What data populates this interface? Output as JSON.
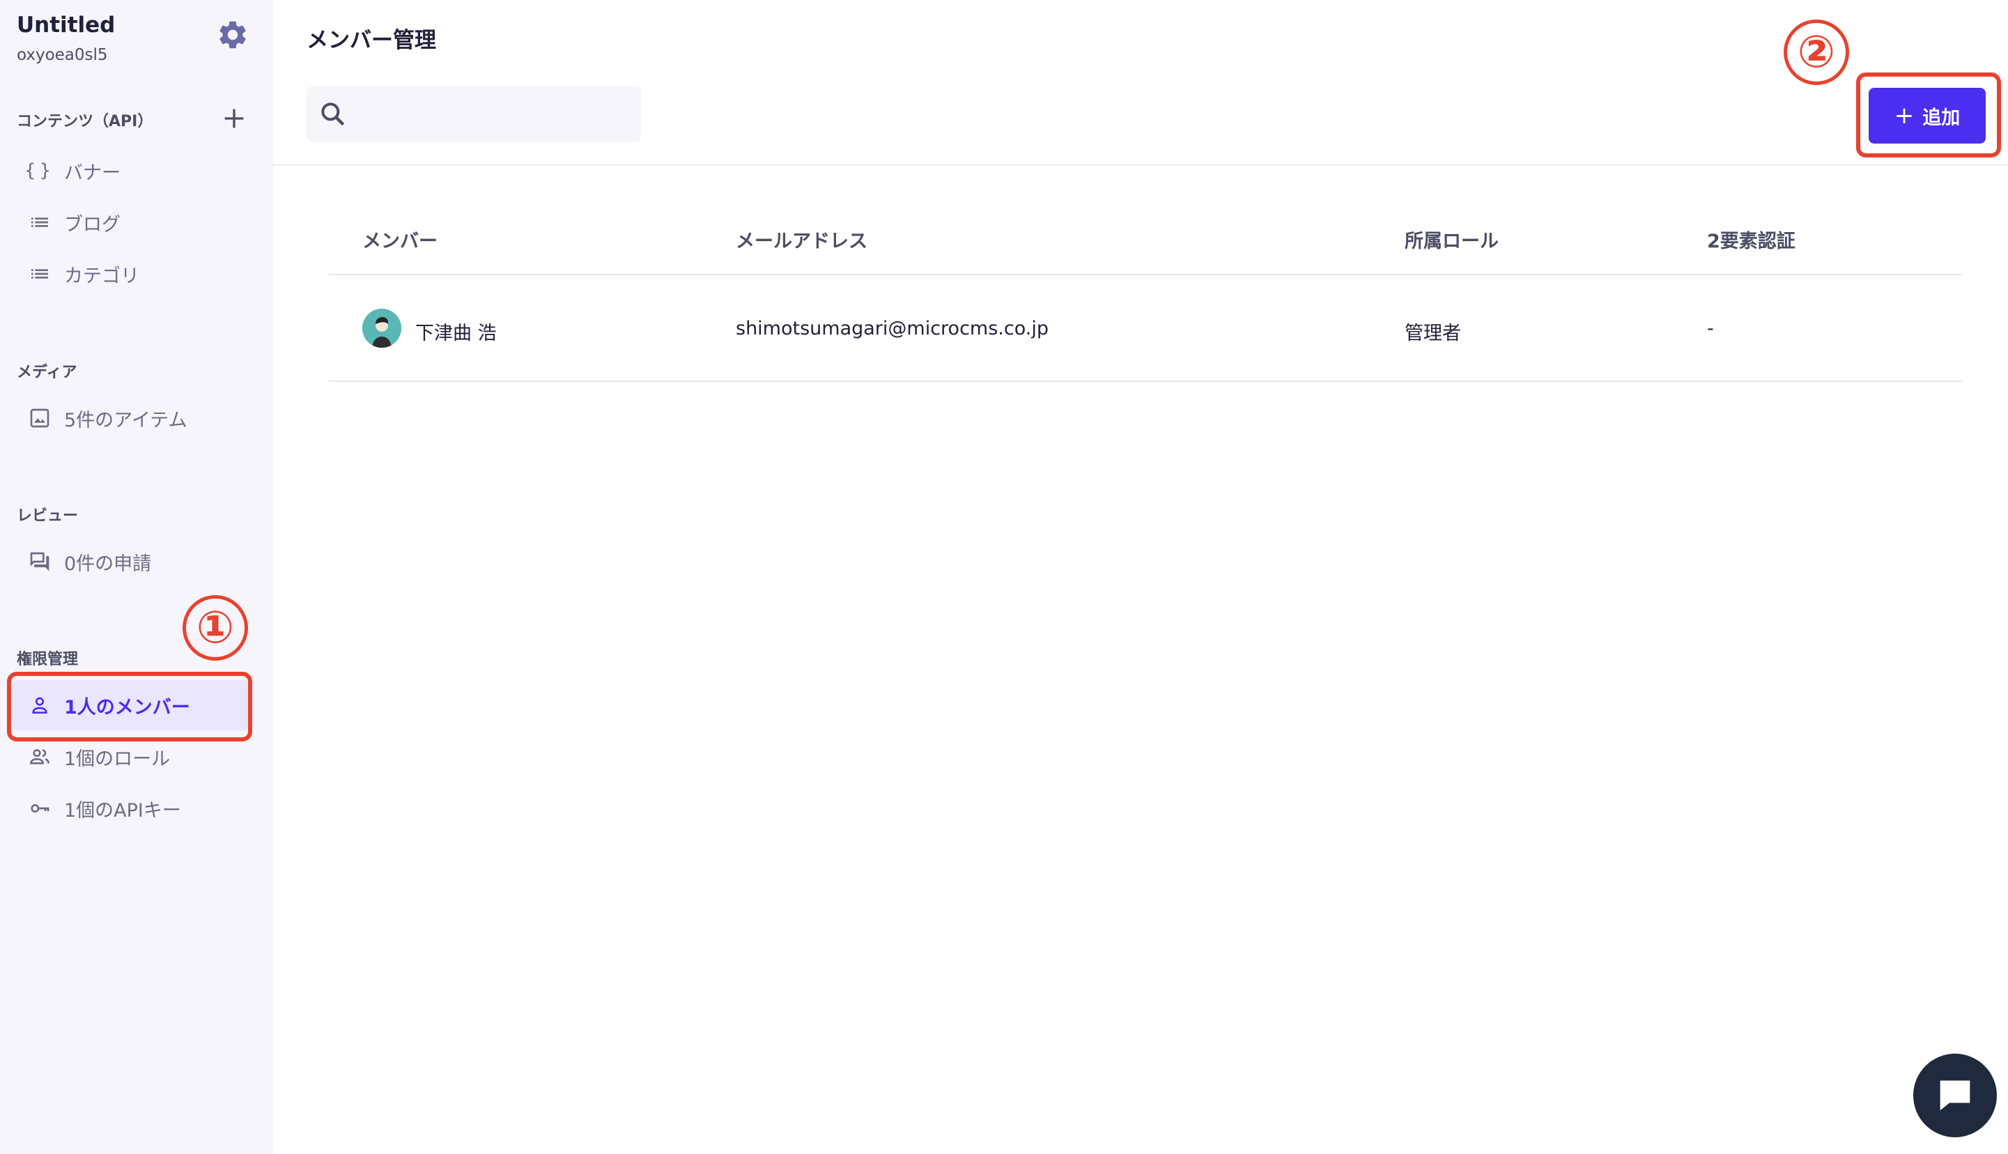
{
  "service": {
    "title": "Untitled",
    "id": "oxyoea0sl5"
  },
  "sidebar": {
    "contents_head": "コンテンツ（API）",
    "contents": [
      {
        "label": "バナー",
        "icon": "braces-icon"
      },
      {
        "label": "ブログ",
        "icon": "list-icon"
      },
      {
        "label": "カテゴリ",
        "icon": "list-icon"
      }
    ],
    "media_head": "メディア",
    "media_item": "5件のアイテム",
    "review_head": "レビュー",
    "review_item": "0件の申請",
    "perm_head": "権限管理",
    "perm_items": [
      {
        "label": "1人のメンバー",
        "icon": "person-icon",
        "active": true
      },
      {
        "label": "1個のロール",
        "icon": "people-icon"
      },
      {
        "label": "1個のAPIキー",
        "icon": "key-icon"
      }
    ]
  },
  "main": {
    "title": "メンバー管理",
    "search": {
      "placeholder": ""
    },
    "add_label": "追加",
    "table": {
      "headers": [
        "メンバー",
        "メールアドレス",
        "所属ロール",
        "2要素認証"
      ],
      "rows": [
        {
          "name": "下津曲 浩",
          "email": "shimotsumagari@microcms.co.jp",
          "role": "管理者",
          "two_factor": "-"
        }
      ]
    }
  },
  "annotations": [
    "①",
    "②"
  ],
  "colors": {
    "accent": "#4b2ef0",
    "annotation": "#e8422e",
    "sidebar_bg": "#f5f5fb"
  }
}
